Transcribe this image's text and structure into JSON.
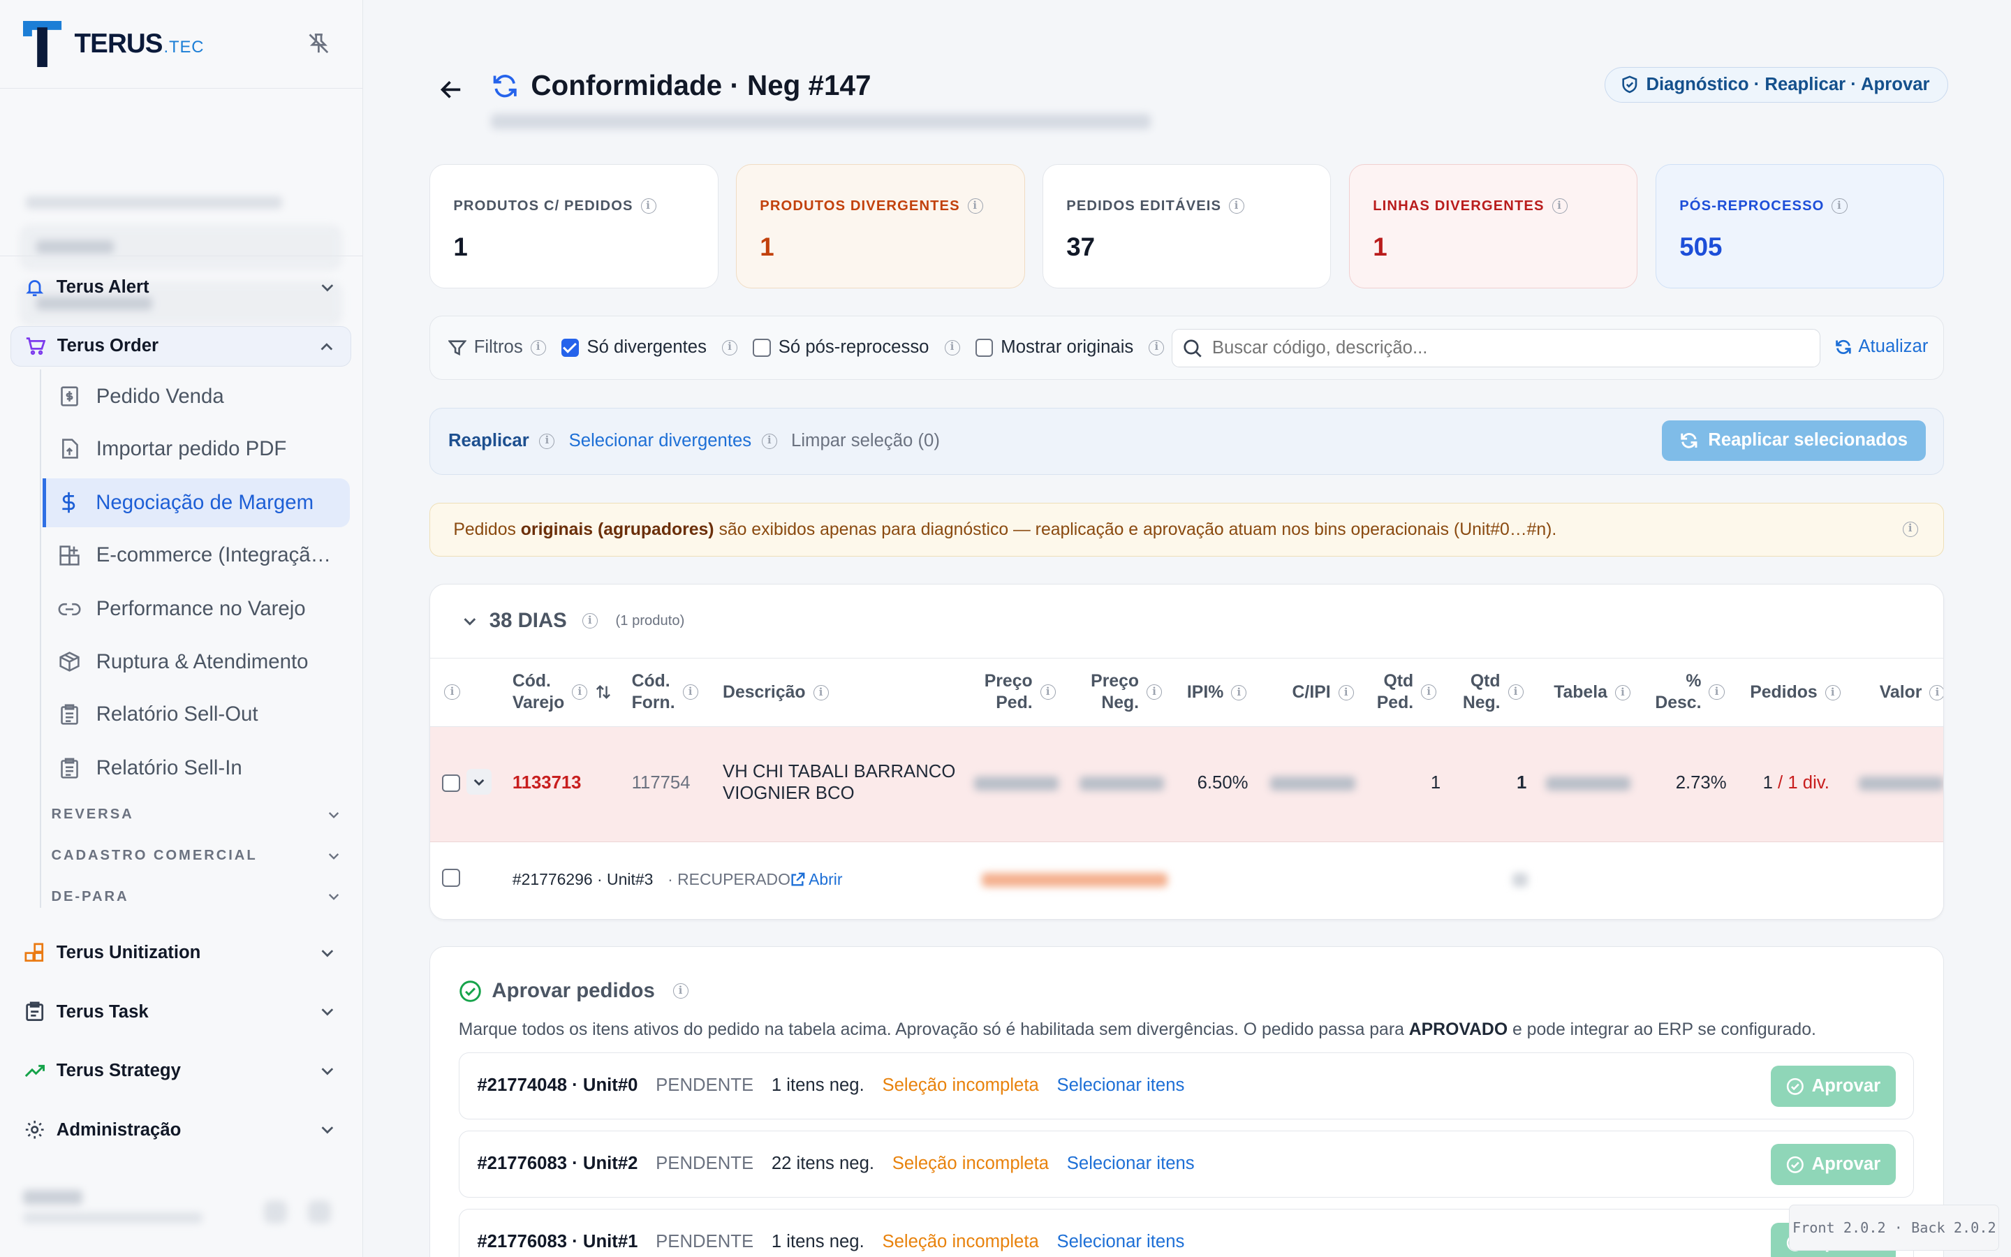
{
  "brand": {
    "name": "TERUS",
    "suffix": ".TEC",
    "accent": "#1c7ed6"
  },
  "sidebar": {
    "groups_top": [
      {
        "label": "Terus Alert",
        "icon": "bell-icon"
      },
      {
        "label": "Terus Order",
        "icon": "cart-icon"
      }
    ],
    "order_items": [
      {
        "label": "Pedido Venda",
        "icon": "receipt-icon"
      },
      {
        "label": "Importar pedido PDF",
        "icon": "file-upload-icon"
      },
      {
        "label": "Negociação de Margem",
        "icon": "dollar-icon",
        "active": true
      },
      {
        "label": "E-commerce (Integração…",
        "icon": "grid-plus-icon"
      },
      {
        "label": "Performance no Varejo",
        "icon": "link-icon"
      },
      {
        "label": "Ruptura & Atendimento",
        "icon": "box-icon"
      },
      {
        "label": "Relatório Sell-Out",
        "icon": "clipboard-icon"
      },
      {
        "label": "Relatório Sell-In",
        "icon": "clipboard-icon"
      }
    ],
    "sections": [
      "REVERSA",
      "CADASTRO COMERCIAL",
      "DE-PARA"
    ],
    "groups_bottom": [
      {
        "label": "Terus Unitization",
        "icon": "grid-icon"
      },
      {
        "label": "Terus Task",
        "icon": "clipboard-icon"
      },
      {
        "label": "Terus Strategy",
        "icon": "trend-icon"
      },
      {
        "label": "Administração",
        "icon": "gear-icon"
      }
    ]
  },
  "header": {
    "title": "Conformidade · Neg #147",
    "badge": "Diagnóstico · Reaplicar · Aprovar"
  },
  "kpis": [
    {
      "label": "PRODUTOS C/ PEDIDOS",
      "value": "1"
    },
    {
      "label": "PRODUTOS DIVERGENTES",
      "value": "1"
    },
    {
      "label": "PEDIDOS EDITÁVEIS",
      "value": "37"
    },
    {
      "label": "LINHAS DIVERGENTES",
      "value": "1"
    },
    {
      "label": "PÓS-REPROCESSO",
      "value": "505"
    }
  ],
  "filters": {
    "label": "Filtros",
    "only_divergent": "Só divergentes",
    "only_post": "Só pós-reprocesso",
    "show_originals": "Mostrar originais",
    "search_placeholder": "Buscar código, descrição...",
    "refresh": "Atualizar"
  },
  "actions": {
    "reapply": "Reaplicar",
    "select_divergent": "Selecionar divergentes",
    "clear_selection": "Limpar seleção (0)",
    "reapply_selected": "Reaplicar selecionados"
  },
  "notice": {
    "pre": "Pedidos ",
    "bold": "originais (agrupadores)",
    "post": " são exibidos apenas para diagnóstico — reaplicação e aprovação atuam nos bins operacionais (Unit#0…#n)."
  },
  "group": {
    "title": "38 DIAS",
    "count": "(1 produto)"
  },
  "table": {
    "headers": {
      "cod_varejo": [
        "Cód.",
        "Varejo"
      ],
      "cod_forn": [
        "Cód.",
        "Forn."
      ],
      "descricao": "Descrição",
      "preco_ped": [
        "Preço",
        "Ped."
      ],
      "preco_neg": [
        "Preço",
        "Neg."
      ],
      "ipi": "IPI%",
      "cipi": "C/IPI",
      "qtd_ped": [
        "Qtd",
        "Ped."
      ],
      "qtd_neg": [
        "Qtd",
        "Neg."
      ],
      "tabela": "Tabela",
      "desc": [
        "%",
        "Desc."
      ],
      "pedidos": "Pedidos",
      "valor": "Valor"
    },
    "row": {
      "cod_varejo": "1133713",
      "cod_forn": "117754",
      "descricao": [
        "VH CHI TABALI BARRANCO",
        "VIOGNIER BCO"
      ],
      "ipi": "6.50%",
      "qtd_ped": "1",
      "qtd_neg": "1",
      "desc": "2.73%",
      "pedidos_count": "1",
      "pedidos_div": "1 div."
    },
    "sub_row": {
      "order": "#21776296 · Unit#3",
      "status": "· RECUPERADO",
      "open": "Abrir"
    }
  },
  "approve": {
    "title": "Aprovar pedidos",
    "desc_pre": "Marque todos os itens ativos do pedido na tabela acima. Aprovação só é habilitada sem divergências. O pedido passa para ",
    "desc_bold": "APROVADO",
    "desc_post": " e pode integrar ao ERP se configurado.",
    "button": "Aprovar",
    "orders": [
      {
        "id": "#21774048 · Unit#0",
        "status": "PENDENTE",
        "items": "1 itens neg.",
        "incomplete": "Seleção incompleta",
        "select": "Selecionar itens"
      },
      {
        "id": "#21776083 · Unit#2",
        "status": "PENDENTE",
        "items": "22 itens neg.",
        "incomplete": "Seleção incompleta",
        "select": "Selecionar itens"
      },
      {
        "id": "#21776083 · Unit#1",
        "status": "PENDENTE",
        "items": "1 itens neg.",
        "incomplete": "Seleção incompleta",
        "select": "Selecionar itens"
      }
    ]
  },
  "version": "Front 2.0.2 · Back 2.0.2"
}
